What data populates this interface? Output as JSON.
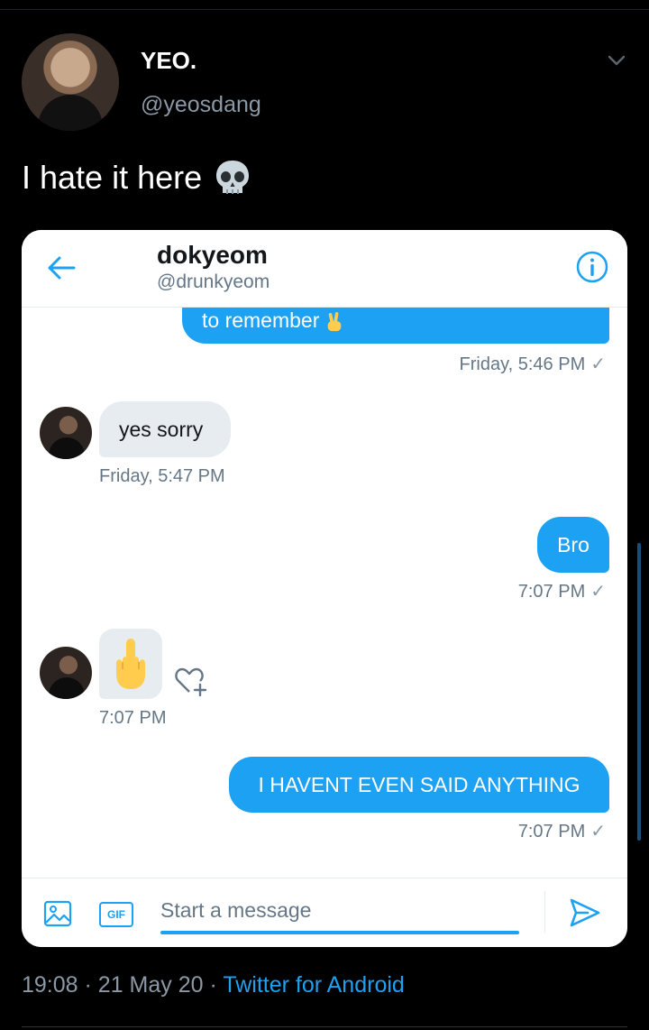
{
  "tweet": {
    "display_name": "YEO.",
    "handle": "@yeosdang",
    "text": "I hate it here",
    "text_emoji": "skull",
    "time": "19:08",
    "date": "21 May 20",
    "separator": "·",
    "source": "Twitter for Android"
  },
  "dm": {
    "name": "dokyeom",
    "handle": "@drunkyeom",
    "messages": [
      {
        "direction": "out",
        "text": "to remember",
        "emoji": "victory-hand"
      },
      {
        "direction": "out-stamp",
        "stamp": "Friday, 5:46 PM",
        "check": "✓"
      },
      {
        "direction": "in",
        "text": "yes sorry",
        "stamp": "Friday, 5:47 PM"
      },
      {
        "direction": "out",
        "text": "Bro",
        "stamp": "7:07 PM",
        "check": "✓"
      },
      {
        "direction": "in",
        "emoji": "middle-finger",
        "stamp": "7:07 PM"
      },
      {
        "direction": "out",
        "text": "I HAVENT EVEN SAID ANYTHING",
        "stamp": "7:07 PM",
        "check": "✓"
      }
    ],
    "composer": {
      "placeholder": "Start a message",
      "gif_label": "GIF"
    }
  },
  "colors": {
    "accent": "#1da1f2",
    "background": "#000000",
    "muted": "#8b98a5"
  }
}
